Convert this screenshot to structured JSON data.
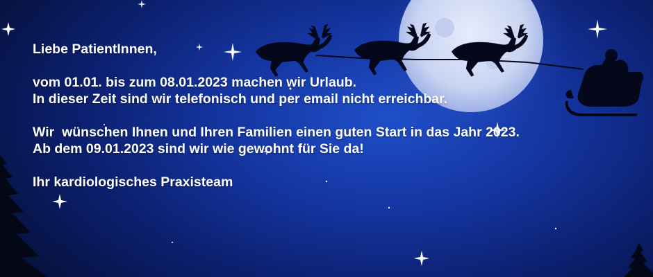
{
  "message": {
    "greeting": "Liebe PatientInnen,",
    "vacation_line": "vom 01.01. bis zum 08.01.2023 machen wir Urlaub.",
    "unreachable_line": "In dieser Zeit sind wir telefonisch und per email nicht erreichbar.",
    "wishes_line": "Wir  wünschen Ihnen und Ihren Familien einen guten Start in das Jahr 2023.",
    "return_line": "Ab dem 09.01.2023 sind wir wie gewohnt für Sie da!",
    "signature": "Ihr kardiologisches Praxisteam"
  },
  "scene": {
    "background_color": "#0b1f6e",
    "moon_color": "#c9d4f2",
    "silhouette_color": "#05081a",
    "star_color": "#ffffff",
    "icons": [
      "moon-icon",
      "reindeer-icon",
      "santa-sleigh-icon",
      "fir-tree-icon",
      "star-icon"
    ]
  }
}
